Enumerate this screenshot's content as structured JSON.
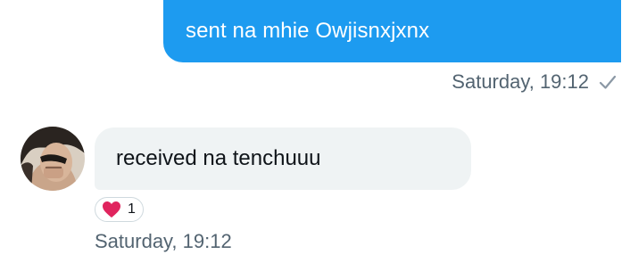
{
  "colors": {
    "sent_bubble": "#1d9bf0",
    "received_bubble": "#eff3f4",
    "timestamp": "#536471",
    "heart": "#f91880"
  },
  "messages": [
    {
      "direction": "sent",
      "text": "sent na mhie Owjisnxjxnx",
      "timestamp": "Saturday, 19:12",
      "status_icon": "check-icon"
    },
    {
      "direction": "received",
      "text": "received na tenchuuu",
      "timestamp": "Saturday, 19:12",
      "avatar_icon": "avatar",
      "reaction": {
        "icon": "heart-icon",
        "count": "1"
      }
    }
  ]
}
